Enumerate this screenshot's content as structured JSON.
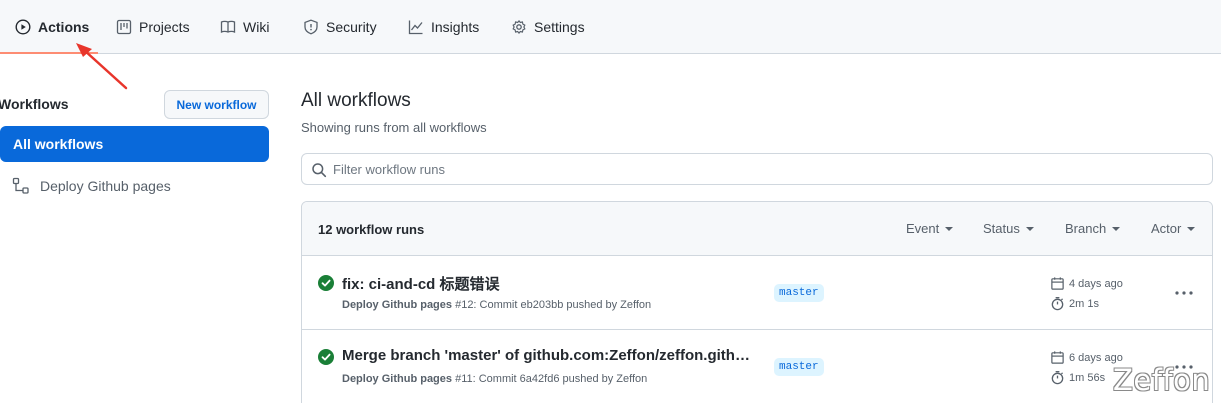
{
  "nav": {
    "tabs": [
      {
        "label": "Actions",
        "icon": "play-icon",
        "active": true
      },
      {
        "label": "Projects",
        "icon": "project-icon"
      },
      {
        "label": "Wiki",
        "icon": "book-icon"
      },
      {
        "label": "Security",
        "icon": "shield-icon"
      },
      {
        "label": "Insights",
        "icon": "graph-icon"
      },
      {
        "label": "Settings",
        "icon": "gear-icon"
      }
    ],
    "active_underline_color": "#fd8c73"
  },
  "annotation": {
    "type": "red-arrow",
    "color": "#e8352b"
  },
  "sidebar": {
    "title": "Workflows",
    "new_button": "New workflow",
    "items": [
      {
        "label": "All workflows",
        "active": true
      },
      {
        "label": "Deploy Github pages",
        "icon": "workflow-icon"
      }
    ]
  },
  "main": {
    "title": "All workflows",
    "subtitle": "Showing runs from all workflows",
    "filter_placeholder": "Filter workflow runs"
  },
  "runs": {
    "count_label": "12 workflow runs",
    "filters": [
      "Event",
      "Status",
      "Branch",
      "Actor"
    ],
    "items": [
      {
        "status": "success",
        "title": "fix: ci-and-cd 标题错误",
        "workflow": "Deploy Github pages",
        "detail": "#12: Commit eb203bb pushed by Zeffon",
        "branch": "master",
        "date": "4 days ago",
        "duration": "2m 1s"
      },
      {
        "status": "success",
        "title": "Merge branch 'master' of github.com:Zeffon/zeffon.github.io",
        "workflow": "Deploy Github pages",
        "detail": "#11: Commit 6a42fd6 pushed by Zeffon",
        "branch": "master",
        "date": "6 days ago",
        "duration": "1m 56s"
      }
    ]
  },
  "watermark": "Zeffon",
  "colors": {
    "accent": "#0969da",
    "success": "#1a7f37",
    "border": "#d0d7de",
    "header_bg": "#f6f8fa"
  }
}
